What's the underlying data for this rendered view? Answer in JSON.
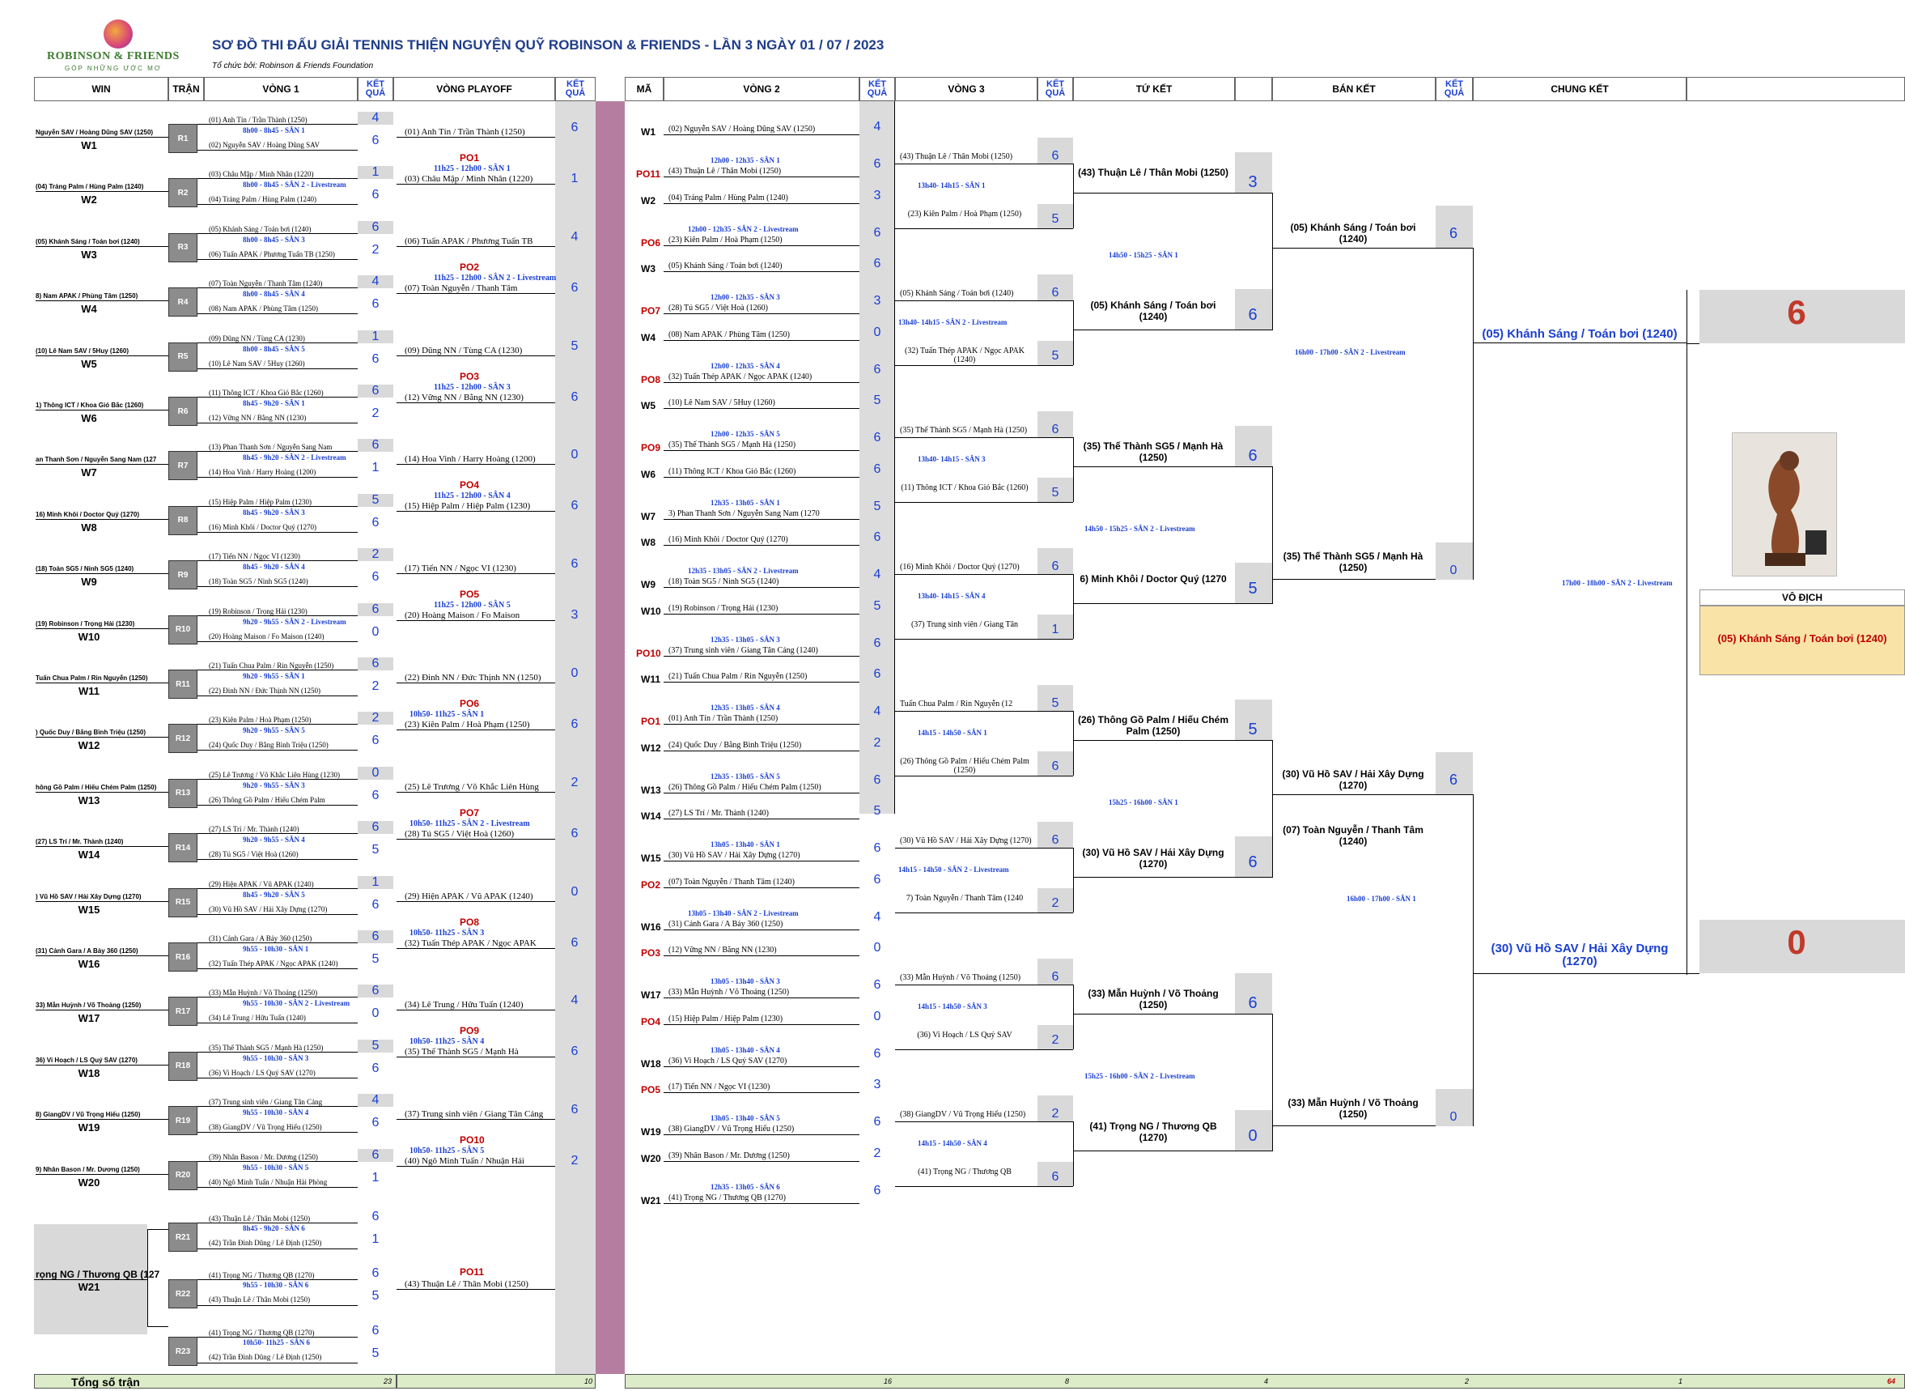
{
  "title": "SƠ ĐỒ THI ĐẤU GIẢI TENNIS THIỆN NGUYỆN QUỸ ROBINSON & FRIENDS -  LẦN 3 NGÀY 01 / 07 / 2023",
  "organizer": "Tổ chức bởi: Robinson & Friends Foundation",
  "logo": {
    "name": "ROBINSON & FRIENDS",
    "tagline": "GÓP NHỮNG ƯỚC MƠ"
  },
  "headers": {
    "win": "WIN",
    "tran": "TRẬN",
    "vong1": "VÒNG 1",
    "ketqua": "KẾT QUẢ",
    "playoff": "VÒNG PLAYOFF",
    "ma": "MÃ",
    "vong2": "VÒNG 2",
    "vong3": "VÒNG 3",
    "tuket": "TỨ KẾT",
    "banket": "BÁN KẾT",
    "chungket": "CHUNG KẾT"
  },
  "round1": [
    {
      "win": "Nguyễn SAV / Hoàng Dũng SAV (1250)",
      "w": "W1",
      "r": "R1",
      "a": "(01) Anh Tín / Trần Thành (1250)",
      "sa": "4",
      "time": "8h00 - 8h45 - SÂN 1",
      "b": "(02) Nguyễn SAV / Hoàng Dũng SAV",
      "sb": "6"
    },
    {
      "win": "(04) Tráng Palm / Hùng Palm (1240)",
      "w": "W2",
      "r": "R2",
      "a": "(03) Châu Mập / Minh Nhân (1220)",
      "sa": "1",
      "time": "8h00 - 8h45 - SÂN 2 - Livestream",
      "b": "(04) Tráng Palm / Hùng Palm (1240)",
      "sb": "6"
    },
    {
      "win": "(05) Khánh Sáng / Toán bơi (1240)",
      "w": "W3",
      "r": "R3",
      "a": "(05) Khánh Sáng / Toán bơi (1240)",
      "sa": "6",
      "time": "8h00 - 8h45 - SÂN 3",
      "b": "(06) Tuấn APAK / Phương Tuấn TB (1250)",
      "sb": "2"
    },
    {
      "win": "8) Nam APAK / Phùng Tâm (1250)",
      "w": "W4",
      "r": "R4",
      "a": "(07) Toàn Nguyễn / Thanh Tâm (1240)",
      "sa": "4",
      "time": "8h00 - 8h45 - SÂN 4",
      "b": "(08) Nam APAK / Phùng Tâm (1250)",
      "sb": "6"
    },
    {
      "win": "(10) Lê Nam SAV / 5Huy (1260)",
      "w": "W5",
      "r": "R5",
      "a": "(09) Dũng NN / Tùng CA (1230)",
      "sa": "1",
      "time": "8h00 - 8h45 - SÂN 5",
      "b": "(10) Lê Nam SAV / 5Huy (1260)",
      "sb": "6"
    },
    {
      "win": "1) Thông ICT / Khoa Gió Bắc (1260)",
      "w": "W6",
      "r": "R6",
      "a": "(11) Thông ICT / Khoa Gió Bắc (1260)",
      "sa": "6",
      "time": "8h45 - 9h20 - SÂN 1",
      "b": "(12) Vững NN / Bằng NN (1230)",
      "sb": "2"
    },
    {
      "win": "an Thanh Sơn / Nguyễn Sang Nam (127",
      "w": "W7",
      "r": "R7",
      "a": "(13) Phan Thanh Sơn / Nguyễn Sang Nam",
      "sa": "6",
      "time": "8h45 - 9h20 - SÂN 2 - Livestream",
      "b": "(14) Hoa Vinh / Harry Hoàng (1200)",
      "sb": "1"
    },
    {
      "win": "16) Minh Khôi / Doctor Quý (1270)",
      "w": "W8",
      "r": "R8",
      "a": "(15) Hiệp Palm / Hiệp Palm (1230)",
      "sa": "5",
      "time": "8h45 - 9h20 - SÂN 3",
      "b": "(16) Minh Khôi / Doctor Quý (1270)",
      "sb": "6"
    },
    {
      "win": "(18) Toàn SG5 / Ninh SG5 (1240)",
      "w": "W9",
      "r": "R9",
      "a": "(17) Tiến NN / Ngọc VI (1230)",
      "sa": "2",
      "time": "8h45 - 9h20 - SÂN 4",
      "b": "(18) Toàn SG5 / Ninh SG5 (1240)",
      "sb": "6"
    },
    {
      "win": "(19) Robinson / Trọng Hải (1230)",
      "w": "W10",
      "r": "R10",
      "a": "(19) Robinson / Trọng Hải (1230)",
      "sa": "6",
      "time": "9h20 - 9h55 - SÂN 2 - Livestream",
      "b": "(20) Hoàng Maison / Fo Maison (1240)",
      "sb": "0"
    },
    {
      "win": "Tuấn Chua Palm / Rin Nguyễn (1250)",
      "w": "W11",
      "r": "R11",
      "a": "(21) Tuấn Chua Palm / Rin Nguyễn (1250)",
      "sa": "6",
      "time": "9h20 - 9h55 - SÂN 1",
      "b": "(22) Đinh NN / Đức Thịnh NN (1250)",
      "sb": "2"
    },
    {
      "win": ") Quốc Duy / Bằng Bình Triệu (1250)",
      "w": "W12",
      "r": "R12",
      "a": "(23) Kiên Palm / Hoà Phạm (1250)",
      "sa": "2",
      "time": "9h20 - 9h55 - SÂN 5",
      "b": "(24) Quốc Duy / Bằng Bình Triệu (1250)",
      "sb": "6"
    },
    {
      "win": "hông Gồ Palm / Hiếu Chém Palm (1250)",
      "w": "W13",
      "r": "R13",
      "a": "(25) Lê Trương / Võ Khắc Liên Hùng (1230)",
      "sa": "0",
      "time": "9h20 - 9h55 - SÂN 3",
      "b": "(26) Thông Gồ Palm / Hiếu Chém Palm",
      "sb": "6"
    },
    {
      "win": "(27) LS Trí / Mr. Thành (1240)",
      "w": "W14",
      "r": "R14",
      "a": "(27) LS Trí / Mr. Thành (1240)",
      "sa": "6",
      "time": "9h20 - 9h55 - SÂN 4",
      "b": "(28) Tú SG5 / Việt Hoà (1260)",
      "sb": "5"
    },
    {
      "win": ") Vũ Hồ SAV / Hải Xây Dựng (1270)",
      "w": "W15",
      "r": "R15",
      "a": "(29) Hiện APAK / Vũ APAK (1240)",
      "sa": "1",
      "time": "8h45 - 9h20 - SÂN 5",
      "b": "(30) Vũ Hồ SAV / Hải Xây Dựng (1270)",
      "sb": "6"
    },
    {
      "win": "(31) Cảnh Gara / A Bảy 360 (1250)",
      "w": "W16",
      "r": "R16",
      "a": "(31) Cảnh Gara / A Bảy 360 (1250)",
      "sa": "6",
      "time": "9h55 - 10h30 - SÂN 1",
      "b": "(32) Tuấn Thép APAK / Ngọc APAK (1240)",
      "sb": "5"
    },
    {
      "win": "33) Mẫn Huỳnh / Võ Thoảng (1250)",
      "w": "W17",
      "r": "R17",
      "a": "(33) Mẫn Huỳnh / Võ Thoảng (1250)",
      "sa": "6",
      "time": "9h55 - 10h30 - SÂN 2 - Livestream",
      "b": "(34) Lê Trung / Hữu Tuấn (1240)",
      "sb": "0"
    },
    {
      "win": "36) Vi Hoạch / LS Quý SAV (1270)",
      "w": "W18",
      "r": "R18",
      "a": "(35) Thế Thành SG5 / Mạnh Hà (1250)",
      "sa": "5",
      "time": "9h55 - 10h30 - SÂN 3",
      "b": "(36) Vi Hoạch / LS Quý SAV (1270)",
      "sb": "6"
    },
    {
      "win": "8) GiangDV / Vũ Trọng Hiếu (1250)",
      "w": "W19",
      "r": "R19",
      "a": "(37) Trung sinh viên / Giang Tân Cảng",
      "sa": "4",
      "time": "9h55 - 10h30 - SÂN 4",
      "b": "(38) GiangDV / Vũ Trọng Hiếu (1250)",
      "sb": "6"
    },
    {
      "win": "9) Nhân Bason / Mr. Dương (1250)",
      "w": "W20",
      "r": "R20",
      "a": "(39) Nhân Bason / Mr. Dương (1250)",
      "sa": "6",
      "time": "9h55 - 10h30 - SÂN 5",
      "b": "(40) Ngô Minh Tuấn / Nhuận Hải Phòng",
      "sb": "1"
    }
  ],
  "round1_extra": [
    {
      "r": "R21",
      "a": "(43) Thuận Lê / Thân Mobi (1250)",
      "sa": "6",
      "time": "8h45 - 9h20 - SÂN 6",
      "b": "(42) Trần Đình Dũng / Lê Định (1250)",
      "sb": "1"
    },
    {
      "r": "R22",
      "a": "(41) Trọng NG / Thương QB (1270)",
      "sa": "6",
      "time": "9h55 - 10h30 - SÂN 6",
      "b": "(43) Thuận Lê / Thân Mobi (1250)",
      "sb": "5"
    },
    {
      "r": "R23",
      "a": "(41) Trọng NG / Thương QB (1270)",
      "sa": "6",
      "time": "10h50- 11h25 - SÂN 6",
      "b": "(42) Trần Đình Dũng / Lê Định (1250)",
      "sb": "5"
    }
  ],
  "w21": {
    "name": "rọng NG / Thương QB (127",
    "w": "W21"
  },
  "playoff": [
    {
      "a": "(01) Anh Tín / Trần Thành (1250)",
      "sa": "6",
      "po": "PO1",
      "time": "11h25 - 12h00 - SÂN 1",
      "b": "(03) Châu Mập / Minh Nhân (1220)",
      "sb": "1"
    },
    {
      "a": "(06) Tuấn APAK / Phương Tuấn TB",
      "sa": "4",
      "po": "PO2",
      "time": "11h25 - 12h00 - SÂN 2 - Livestream",
      "b": "(07) Toàn Nguyễn / Thanh Tâm",
      "sb": "6"
    },
    {
      "a": "(09) Dũng NN / Tùng CA (1230)",
      "sa": "5",
      "po": "PO3",
      "time": "11h25 - 12h00 - SÂN 3",
      "b": "(12) Vững NN / Bằng NN (1230)",
      "sb": "6"
    },
    {
      "a": "(14) Hoa Vinh / Harry Hoàng (1200)",
      "sa": "0",
      "po": "PO4",
      "time": "11h25 - 12h00 - SÂN 4",
      "b": "(15) Hiệp Palm / Hiệp Palm (1230)",
      "sb": "6"
    },
    {
      "a": "(17) Tiến NN / Ngọc VI (1230)",
      "sa": "6",
      "po": "PO5",
      "time": "11h25 - 12h00 - SÂN 5",
      "b": "(20) Hoàng Maison / Fo Maison",
      "sb": "3"
    },
    {
      "a": "(22) Đinh NN / Đức Thịnh NN (1250)",
      "sa": "0",
      "po": "PO6",
      "time": "10h50- 11h25 - SÂN 1",
      "b": "(23) Kiên Palm / Hoà Phạm (1250)",
      "sb": "6"
    },
    {
      "a": "(25) Lê Trương / Võ Khắc Liên Hùng",
      "sa": "2",
      "po": "PO7",
      "time": "10h50- 11h25 - SÂN 2 - Livestream",
      "b": "(28) Tú SG5 / Việt Hoà (1260)",
      "sb": "6"
    },
    {
      "a": "(29) Hiện APAK / Vũ APAK (1240)",
      "sa": "0",
      "po": "PO8",
      "time": "10h50- 11h25 - SÂN 3",
      "b": "(32) Tuấn Thép APAK / Ngọc APAK",
      "sb": "6"
    },
    {
      "a": "(34) Lê Trung / Hữu Tuấn (1240)",
      "sa": "4",
      "po": "PO9",
      "time": "10h50- 11h25 - SÂN 4",
      "b": "(35) Thế Thành SG5 / Mạnh Hà",
      "sb": "6"
    },
    {
      "a": "(37) Trung sinh viên / Giang Tân Cảng",
      "sa": "6",
      "po": "PO10",
      "time": "10h50- 11h25 - SÂN 5",
      "b": "(40) Ngô Minh Tuấn / Nhuận Hải",
      "sb": "2"
    }
  ],
  "po11": {
    "po": "PO11",
    "a": "(43) Thuận Lê / Thân Mobi (1250)"
  },
  "round2": [
    {
      "ca": "W1",
      "a": "(02) Nguyễn SAV / Hoàng Dũng SAV (1250)",
      "sa": "4",
      "time": "12h00 - 12h35 - SÂN 1",
      "cb": "PO11",
      "b": "(43) Thuận Lê / Thân Mobi (1250)",
      "sb": "6"
    },
    {
      "ca": "W2",
      "a": "(04) Tráng Palm / Hùng Palm (1240)",
      "sa": "3",
      "time": "12h00 - 12h35 - SÂN 2 - Livestream",
      "cb": "PO6",
      "b": "(23) Kiên Palm / Hoà Phạm (1250)",
      "sb": "6"
    },
    {
      "ca": "W3",
      "a": "(05) Khánh Sáng / Toán bơi (1240)",
      "sa": "6",
      "time": "12h00 - 12h35 - SÂN 3",
      "cb": "PO7",
      "b": "(28) Tú SG5 / Việt Hoà (1260)",
      "sb": "3"
    },
    {
      "ca": "W4",
      "a": "(08) Nam APAK / Phùng Tâm (1250)",
      "sa": "0",
      "time": "12h00 - 12h35 - SÂN 4",
      "cb": "PO8",
      "b": "(32) Tuấn Thép APAK / Ngọc APAK (1240)",
      "sb": "6"
    },
    {
      "ca": "W5",
      "a": "(10) Lê Nam SAV / 5Huy (1260)",
      "sa": "5",
      "time": "12h00 - 12h35 - SÂN 5",
      "cb": "PO9",
      "b": "(35) Thế Thành SG5 / Mạnh Hà (1250)",
      "sb": "6"
    },
    {
      "ca": "W6",
      "a": "(11) Thông ICT / Khoa Gió Bắc (1260)",
      "sa": "6",
      "time": "12h35 - 13h05 - SÂN 1",
      "cb": "W7",
      "b": "3) Phan Thanh Sơn / Nguyễn Sang Nam (1270",
      "sb": "5"
    },
    {
      "ca": "W8",
      "a": "(16) Minh Khôi / Doctor Quý (1270)",
      "sa": "6",
      "time": "12h35 - 13h05 - SÂN 2 - Livestream",
      "cb": "W9",
      "b": "(18) Toàn SG5 / Ninh SG5 (1240)",
      "sb": "4"
    },
    {
      "ca": "W10",
      "a": "(19) Robinson / Trọng Hải (1230)",
      "sa": "5",
      "time": "12h35 - 13h05 - SÂN 3",
      "cb": "PO10",
      "b": "(37) Trung sinh viên / Giang Tân Cảng (1240)",
      "sb": "6"
    },
    {
      "ca": "W11",
      "a": "(21) Tuấn Chua Palm / Rin Nguyễn (1250)",
      "sa": "6",
      "time": "12h35 - 13h05 - SÂN 4",
      "cb": "PO1",
      "b": "(01) Anh Tín / Trần Thành (1250)",
      "sb": "4"
    },
    {
      "ca": "W12",
      "a": "(24) Quốc Duy / Bằng Bình Triệu (1250)",
      "sa": "2",
      "time": "12h35 - 13h05 - SÂN 5",
      "cb": "W13",
      "b": "(26) Thông Gồ Palm / Hiếu Chém Palm (1250)",
      "sb": "6"
    },
    {
      "ca": "W14",
      "a": "(27) LS Trí / Mr. Thành (1240)",
      "sa": "5",
      "time": "13h05 - 13h40 - SÂN 1",
      "cb": "W15",
      "b": "(30) Vũ Hồ SAV / Hải Xây Dựng (1270)",
      "sb": "6"
    },
    {
      "ca": "PO2",
      "a": "(07) Toàn Nguyễn / Thanh Tâm (1240)",
      "sa": "6",
      "time": "13h05 - 13h40 - SÂN 2 - Livestream",
      "cb": "W16",
      "b": "(31) Cảnh Gara / A Bảy 360 (1250)",
      "sb": "4"
    },
    {
      "ca": "PO3",
      "a": "(12) Vững NN / Bằng NN (1230)",
      "sa": "0",
      "time": "13h05 - 13h40 - SÂN 3",
      "cb": "W17",
      "b": "(33) Mẫn Huỳnh / Võ Thoảng (1250)",
      "sb": "6"
    },
    {
      "ca": "PO4",
      "a": "(15) Hiệp Palm / Hiệp Palm (1230)",
      "sa": "0",
      "time": "13h05 - 13h40 - SÂN 4",
      "cb": "W18",
      "b": "(36) Vi Hoạch / LS Quý SAV (1270)",
      "sb": "6"
    },
    {
      "ca": "PO5",
      "a": "(17) Tiến NN / Ngọc VI (1230)",
      "sa": "3",
      "time": "13h05 - 13h40 - SÂN 5",
      "cb": "W19",
      "b": "(38) GiangDV / Vũ Trọng Hiếu (1250)",
      "sb": "6"
    },
    {
      "ca": "W20",
      "a": "(39) Nhân Bason / Mr. Dương (1250)",
      "sa": "2",
      "time": "12h35 - 13h05 - SÂN 6",
      "cb": "W21",
      "b": "(41) Trọng NG / Thương QB (1270)",
      "sb": "6"
    }
  ],
  "round3": [
    {
      "a": "(43) Thuận Lê / Thân Mobi (1250)",
      "sa": "6",
      "time": "13h40- 14h15 - SÂN 1",
      "b": "(23) Kiên Palm / Hoà Phạm (1250)",
      "sb": "5"
    },
    {
      "a": "(05) Khánh Sáng / Toán bơi (1240)",
      "sa": "6",
      "time": "13h40- 14h15 - SÂN 2 - Livestream",
      "b": "(32) Tuấn Thép APAK / Ngọc APAK (1240)",
      "sb": "5"
    },
    {
      "a": "(35) Thế Thành SG5 / Mạnh Hà (1250)",
      "sa": "6",
      "time": "13h40- 14h15 - SÂN 3",
      "b": "(11) Thông ICT / Khoa Gió Bắc (1260)",
      "sb": "5"
    },
    {
      "a": "(16) Minh Khôi / Doctor Quý (1270)",
      "sa": "6",
      "time": "13h40- 14h15 - SÂN 4",
      "b": "(37) Trung sinh viên / Giang Tân",
      "sb": "1"
    },
    {
      "a": "Tuấn Chua Palm / Rin Nguyễn (12",
      "sa": "5",
      "time": "14h15 - 14h50 - SÂN 1",
      "b": "(26) Thông Gồ Palm / Hiếu Chém Palm (1250)",
      "sb": "6"
    },
    {
      "a": "(30) Vũ Hồ SAV / Hải Xây Dựng (1270)",
      "sa": "6",
      "time": "14h15 - 14h50 - SÂN 2 - Livestream",
      "b": "7) Toàn Nguyễn / Thanh Tâm (1240",
      "sb": "2"
    },
    {
      "a": "(33) Mẫn Huỳnh / Võ Thoảng (1250)",
      "sa": "6",
      "time": "14h15 - 14h50 - SÂN 3",
      "b": "(36) Vi Hoạch / LS Quý SAV",
      "sb": "2"
    },
    {
      "a": "(38) GiangDV / Vũ Trọng Hiếu (1250)",
      "sa": "2",
      "time": "14h15 - 14h50 - SÂN 4",
      "b": "(41) Trọng NG / Thương QB",
      "sb": "6"
    }
  ],
  "quarter": [
    {
      "a": "(43) Thuận Lê / Thân Mobi (1250)",
      "sa": "3",
      "time": "14h50 - 15h25 - SÂN 1",
      "b": "(05) Khánh Sáng / Toán bơi (1240)",
      "sb": "6"
    },
    {
      "a": "(35) Thế Thành SG5 / Mạnh Hà (1250)",
      "sa": "6",
      "time": "14h50 - 15h25 - SÂN 2 - Livestream",
      "b": "6) Minh Khôi / Doctor Quý (1270",
      "sb": "5"
    },
    {
      "a": "(26) Thông Gồ Palm / Hiếu Chém Palm (1250)",
      "sa": "5",
      "time": "15h25 - 16h00 - SÂN 1",
      "b": "(30) Vũ Hồ SAV / Hải Xây Dựng (1270)",
      "sb": "6"
    },
    {
      "a": "(33) Mẫn Huỳnh / Võ Thoảng (1250)",
      "sa": "6",
      "time": "15h25 - 16h00 - SÂN 2 - Livestream",
      "b": "(41) Trọng NG / Thương QB (1270)",
      "sb": "0"
    }
  ],
  "semi": [
    {
      "a": "(05) Khánh Sáng / Toán bơi (1240)",
      "sa": "6",
      "time": "16h00 - 17h00 - SÂN 2 - Livestream",
      "b": "(35) Thế Thành SG5 / Mạnh Hà (1250)",
      "sb": "0"
    },
    {
      "a": "(30) Vũ Hồ SAV / Hải Xây Dựng (1270)",
      "sa": "6",
      "time": "16h00 - 17h00 - SÂN 1",
      "b": "(33) Mẫn Huỳnh / Võ Thoảng (1250)",
      "sb": "0"
    },
    {
      "extra": "(07) Toàn Nguyễn / Thanh Tâm (1240)"
    }
  ],
  "final": {
    "a": "(05) Khánh Sáng / Toán bơi (1240)",
    "sa": "6",
    "time": "17h00 - 18h00 - SÂN 2 - Livestream",
    "b": "(30) Vũ Hồ SAV / Hải Xây Dựng (1270)",
    "sb": "0"
  },
  "champion": {
    "label": "VÔ ĐỊCH",
    "name": "(05) Khánh Sáng / Toán bơi (1240)"
  },
  "footer": {
    "label": "Tổng số trận",
    "n1": "23",
    "n2": "10",
    "n3": "16",
    "n4": "8",
    "n5": "4",
    "n6": "2",
    "n7": "1",
    "total": "64"
  },
  "colors": {
    "accent": "#1a3fd0",
    "red": "#c00000",
    "gray": "#d9d9d9",
    "pink": "#b57ea0",
    "champion_bg": "#f9e3a6",
    "footer_bg": "#dcebc8"
  }
}
